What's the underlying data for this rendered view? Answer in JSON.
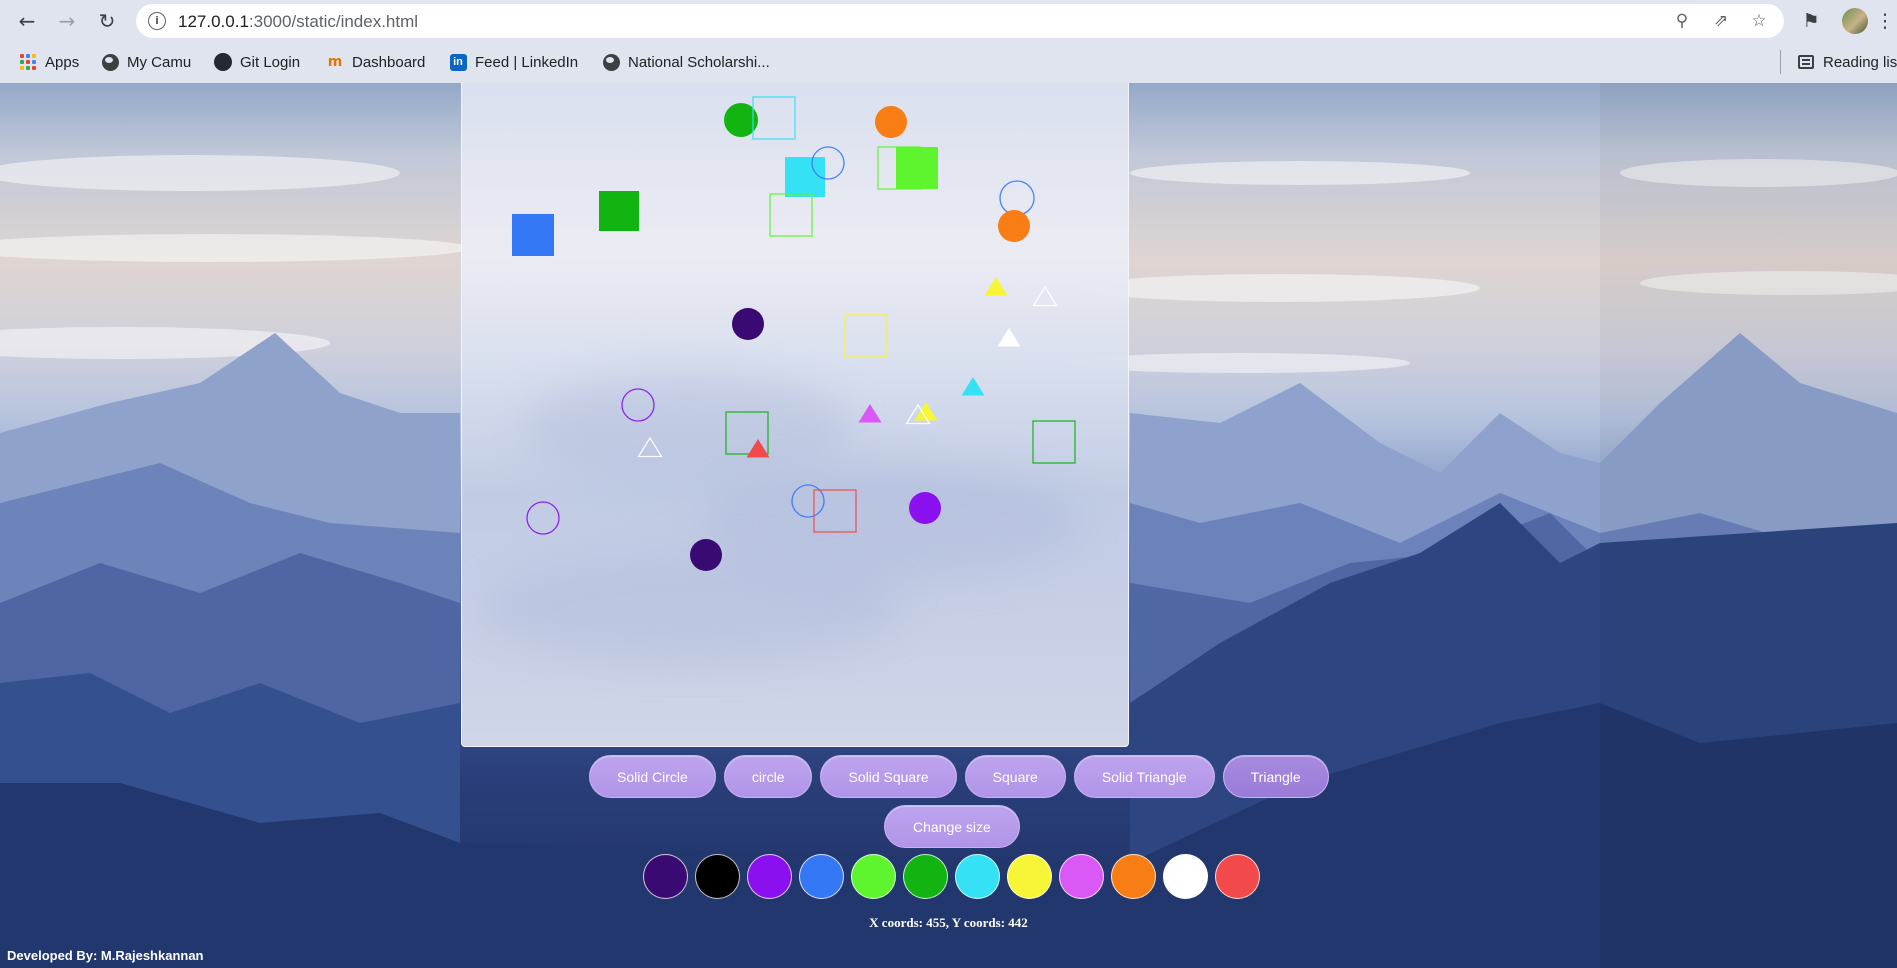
{
  "browser": {
    "url_host": "127.0.0.1",
    "url_path": ":3000/static/index.html",
    "bookmarks": [
      {
        "label": "Apps",
        "icon": "apps-grid-icon"
      },
      {
        "label": "My Camu",
        "icon": "globe-icon"
      },
      {
        "label": "Git Login",
        "icon": "github-icon"
      },
      {
        "label": "Dashboard",
        "icon": "dashboard-icon"
      },
      {
        "label": "Feed | LinkedIn",
        "icon": "linkedin-icon"
      },
      {
        "label": "National Scholarshi...",
        "icon": "globe-icon"
      }
    ],
    "reading_list_label": "Reading lis"
  },
  "toolbar_icons": {
    "back": "back-arrow-icon",
    "forward": "forward-arrow-icon",
    "reload": "reload-icon",
    "zoom": "zoom-icon",
    "share": "share-icon",
    "bookmark": "star-icon",
    "extensions": "puzzle-icon",
    "menu": "more-vertical-icon"
  },
  "app": {
    "shape_buttons": [
      "Solid Circle",
      "circle",
      "Solid Square",
      "Square",
      "Solid Triangle",
      "Triangle"
    ],
    "active_shape": "Triangle",
    "change_size_label": "Change size",
    "palette": [
      "#3a0a73",
      "#000000",
      "#8a10f0",
      "#3478f6",
      "#5ef52e",
      "#11b411",
      "#35e1f5",
      "#f6f538",
      "#da58f5",
      "#f77d14",
      "#ffffff",
      "#f2494a"
    ],
    "coords_text": "X coords: 455, Y coords: 442",
    "footer_text": "Developed By: M.Rajeshkannan"
  },
  "drawn_shapes": [
    {
      "kind": "solid-circle",
      "color": "#11b411"
    },
    {
      "kind": "square",
      "color": "#35e1f5"
    },
    {
      "kind": "solid-circle",
      "color": "#f77d14"
    },
    {
      "kind": "solid-square",
      "color": "#35e1f5"
    },
    {
      "kind": "circle",
      "color": "#3478f6"
    },
    {
      "kind": "square",
      "color": "#5ef52e"
    },
    {
      "kind": "solid-square",
      "color": "#5ef52e"
    },
    {
      "kind": "circle",
      "color": "#3478f6"
    },
    {
      "kind": "solid-circle",
      "color": "#f77d14"
    },
    {
      "kind": "square",
      "color": "#5ef52e"
    },
    {
      "kind": "solid-square",
      "color": "#11b411"
    },
    {
      "kind": "solid-square",
      "color": "#3478f6"
    },
    {
      "kind": "solid-triangle",
      "color": "#f6f538"
    },
    {
      "kind": "triangle",
      "color": "#ffffff"
    },
    {
      "kind": "solid-circle",
      "color": "#3a0a73"
    },
    {
      "kind": "square",
      "color": "#f6f538"
    },
    {
      "kind": "solid-triangle",
      "color": "#ffffff"
    },
    {
      "kind": "solid-triangle",
      "color": "#35e1f5"
    },
    {
      "kind": "circle",
      "color": "#8a10f0"
    },
    {
      "kind": "square",
      "color": "#11b411"
    },
    {
      "kind": "solid-triangle",
      "color": "#da58f5"
    },
    {
      "kind": "solid-triangle",
      "color": "#f6f538"
    },
    {
      "kind": "triangle",
      "color": "#ffffff"
    },
    {
      "kind": "triangle",
      "color": "#ffffff"
    },
    {
      "kind": "solid-triangle",
      "color": "#f2494a"
    },
    {
      "kind": "square",
      "color": "#11b411"
    },
    {
      "kind": "circle",
      "color": "#3478f6"
    },
    {
      "kind": "square",
      "color": "#f2494a"
    },
    {
      "kind": "solid-circle",
      "color": "#8a10f0"
    },
    {
      "kind": "circle",
      "color": "#8a10f0"
    },
    {
      "kind": "solid-circle",
      "color": "#3a0a73"
    }
  ]
}
